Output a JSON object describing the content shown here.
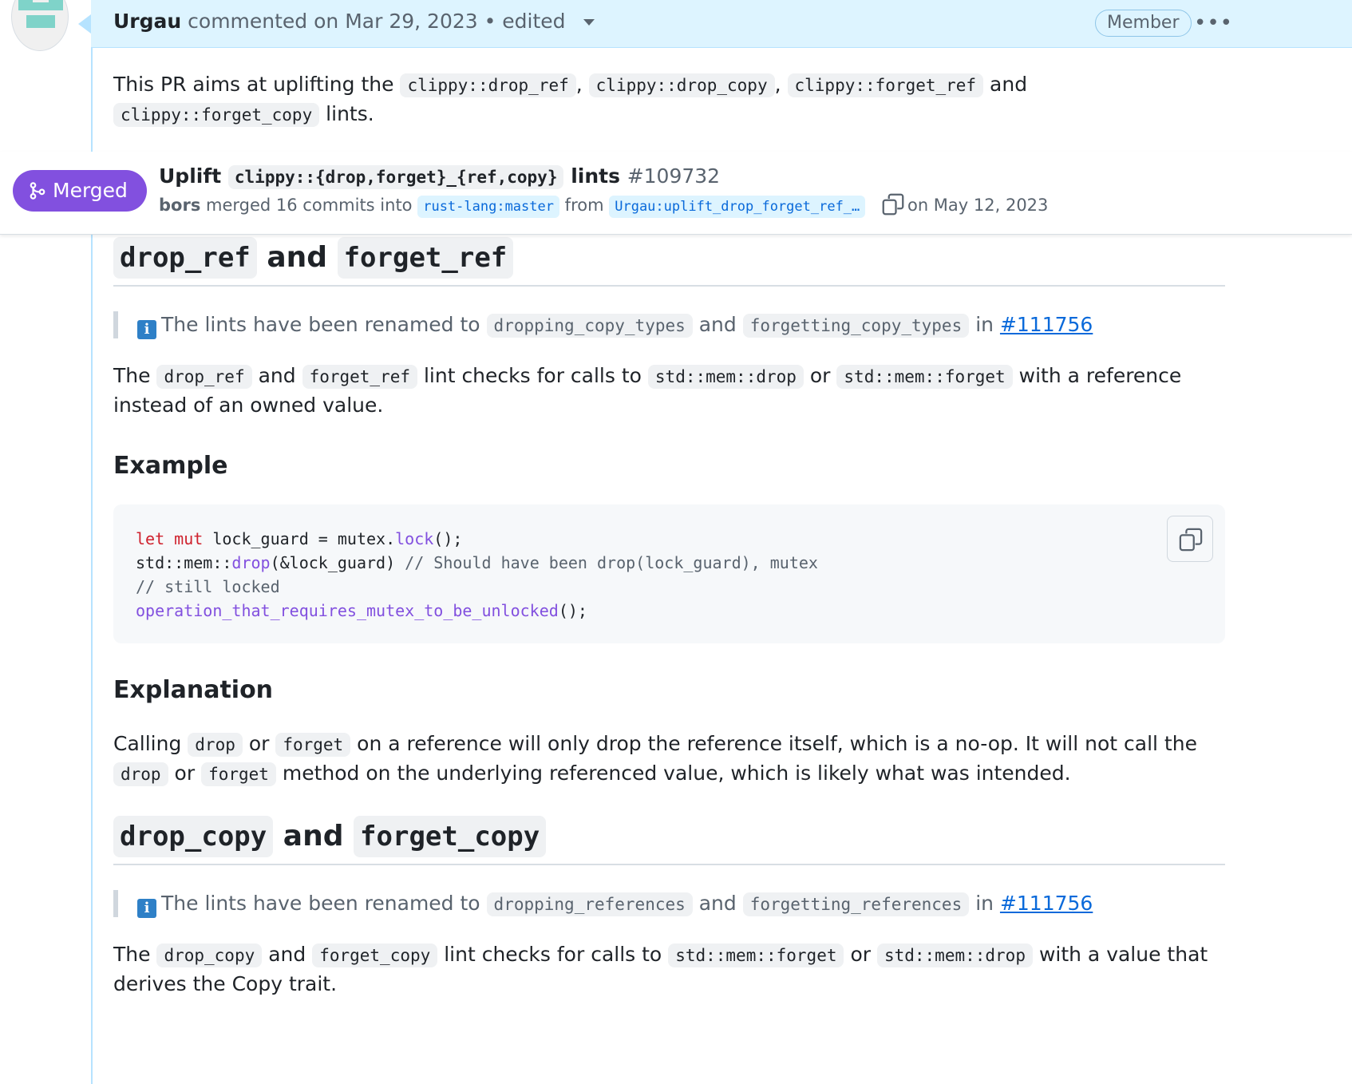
{
  "comment": {
    "author": "Urgau",
    "action": "commented on Mar 29, 2023 • edited",
    "role_badge": "Member",
    "intro": {
      "prefix": "This PR aims at uplifting the",
      "lints": [
        "clippy::drop_ref",
        "clippy::drop_copy",
        "clippy::forget_ref",
        "clippy::forget_copy"
      ],
      "sep1": ",",
      "sep2": ",",
      "and": "and",
      "suffix": "lints."
    }
  },
  "pr": {
    "state": "Merged",
    "title_prefix": "Uplift",
    "title_code": "clippy::{drop,forget}_{ref,copy}",
    "title_suffix": "lints",
    "number": "#109732",
    "actor": "bors",
    "merged_text": "merged 16 commits into",
    "base_branch": "rust-lang:master",
    "from_text": "from",
    "head_branch": "Urgau:uplift_drop_forget_ref_…",
    "date": "on May 12, 2023"
  },
  "section1": {
    "h_code1": "drop_ref",
    "h_and": "and",
    "h_code2": "forget_ref",
    "note": {
      "prefix": "The lints have been renamed to",
      "name1": "dropping_copy_types",
      "and": "and",
      "name2": "forgetting_copy_types",
      "in": "in",
      "link": "#111756"
    },
    "para": {
      "t1": "The",
      "c1": "drop_ref",
      "t2": "and",
      "c2": "forget_ref",
      "t3": "lint checks for calls to",
      "c3": "std::mem::drop",
      "t4": "or",
      "c4": "std::mem::forget",
      "t5": "with a reference instead of an owned value."
    },
    "example_heading": "Example",
    "code": {
      "l1_kw1": "let",
      "l1_kw2": "mut",
      "l1_rest1": " lock_guard = mutex.",
      "l1_fn": "lock",
      "l1_rest2": "();",
      "l2_path": "std::mem::",
      "l2_fn": "drop",
      "l2_args": "(&lock_guard) ",
      "l2_comment": "// Should have been drop(lock_guard), mutex",
      "l3_comment": "// still locked",
      "l4_fn": "operation_that_requires_mutex_to_be_unlocked",
      "l4_rest": "();"
    },
    "explanation_heading": "Explanation",
    "explanation": {
      "t1": "Calling",
      "c1": "drop",
      "t2": "or",
      "c2": "forget",
      "t3": "on a reference will only drop the reference itself, which is a no-op. It will not call the",
      "c3": "drop",
      "t4": "or",
      "c4": "forget",
      "t5": "method on the underlying referenced value, which is likely what was intended."
    }
  },
  "section2": {
    "h_code1": "drop_copy",
    "h_and": "and",
    "h_code2": "forget_copy",
    "note": {
      "prefix": "The lints have been renamed to",
      "name1": "dropping_references",
      "and": "and",
      "name2": "forgetting_references",
      "in": "in",
      "link": "#111756"
    },
    "para": {
      "t1": "The",
      "c1": "drop_copy",
      "t2": "and",
      "c2": "forget_copy",
      "t3": "lint checks for calls to",
      "c3": "std::mem::forget",
      "t4": "or",
      "c4": "std::mem::drop",
      "t5": "with a value that derives the Copy trait."
    }
  },
  "icons": {
    "avatar": "identicon-avatar",
    "merge": "git-merge-icon",
    "copy": "copy-icon",
    "info": "info-icon",
    "more": "kebab-menu-icon",
    "dropdown": "caret-down-icon"
  },
  "colors": {
    "merged": "#8250df",
    "header_bg": "#ddf4ff",
    "link": "#0969da"
  }
}
